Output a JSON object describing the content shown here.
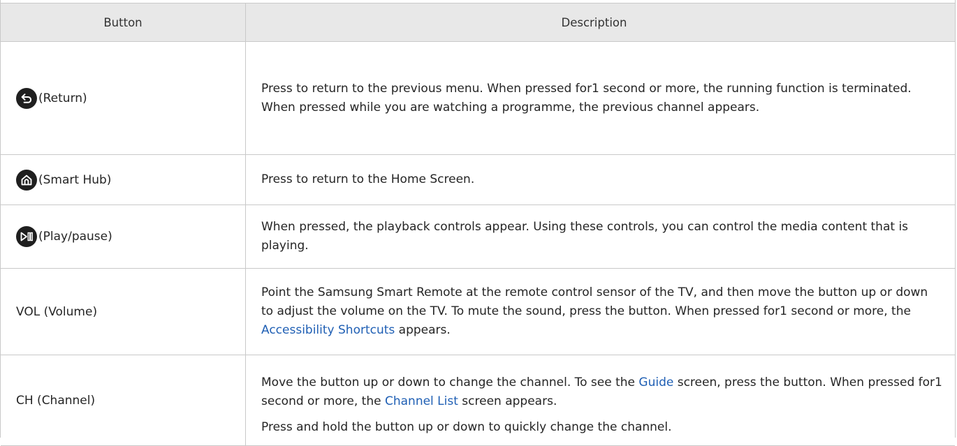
{
  "header": {
    "button": "Button",
    "description": "Description"
  },
  "rows": [
    {
      "icon": "return-icon",
      "label": "(Return)",
      "description": "Press to return to the previous menu. When pressed for1 second or more, the running function is terminated. When pressed while you are watching a programme, the previous channel appears."
    },
    {
      "icon": "home-icon",
      "label": "(Smart Hub)",
      "description": "Press to return to the Home Screen."
    },
    {
      "icon": "play-pause-icon",
      "label": "(Play/pause)",
      "description": "When pressed, the playback controls appear. Using these controls, you can control the media content that is playing."
    },
    {
      "label": "VOL (Volume)",
      "description_before": "Point the Samsung Smart Remote at the remote control sensor of the TV, and then move the button up or down to adjust the volume on the TV. To mute the sound, press the button. When pressed for1 second or more, the ",
      "description_link": "Accessibility Shortcuts",
      "description_after": " appears."
    },
    {
      "label": "CH (Channel)",
      "p1_a": "Move the button up or down to change the channel. To see the ",
      "p1_link1": "Guide",
      "p1_b": " screen, press the button. When pressed for1 second or more, the ",
      "p1_link2": "Channel List",
      "p1_c": " screen appears.",
      "p2": "Press and hold the button up or down to quickly change the channel."
    }
  ],
  "colors": {
    "header_bg": "#e8e8e8",
    "border": "#c9c9c9",
    "text": "#252525",
    "link": "#1f5fb4",
    "icon_bg": "#1f1f1f"
  }
}
